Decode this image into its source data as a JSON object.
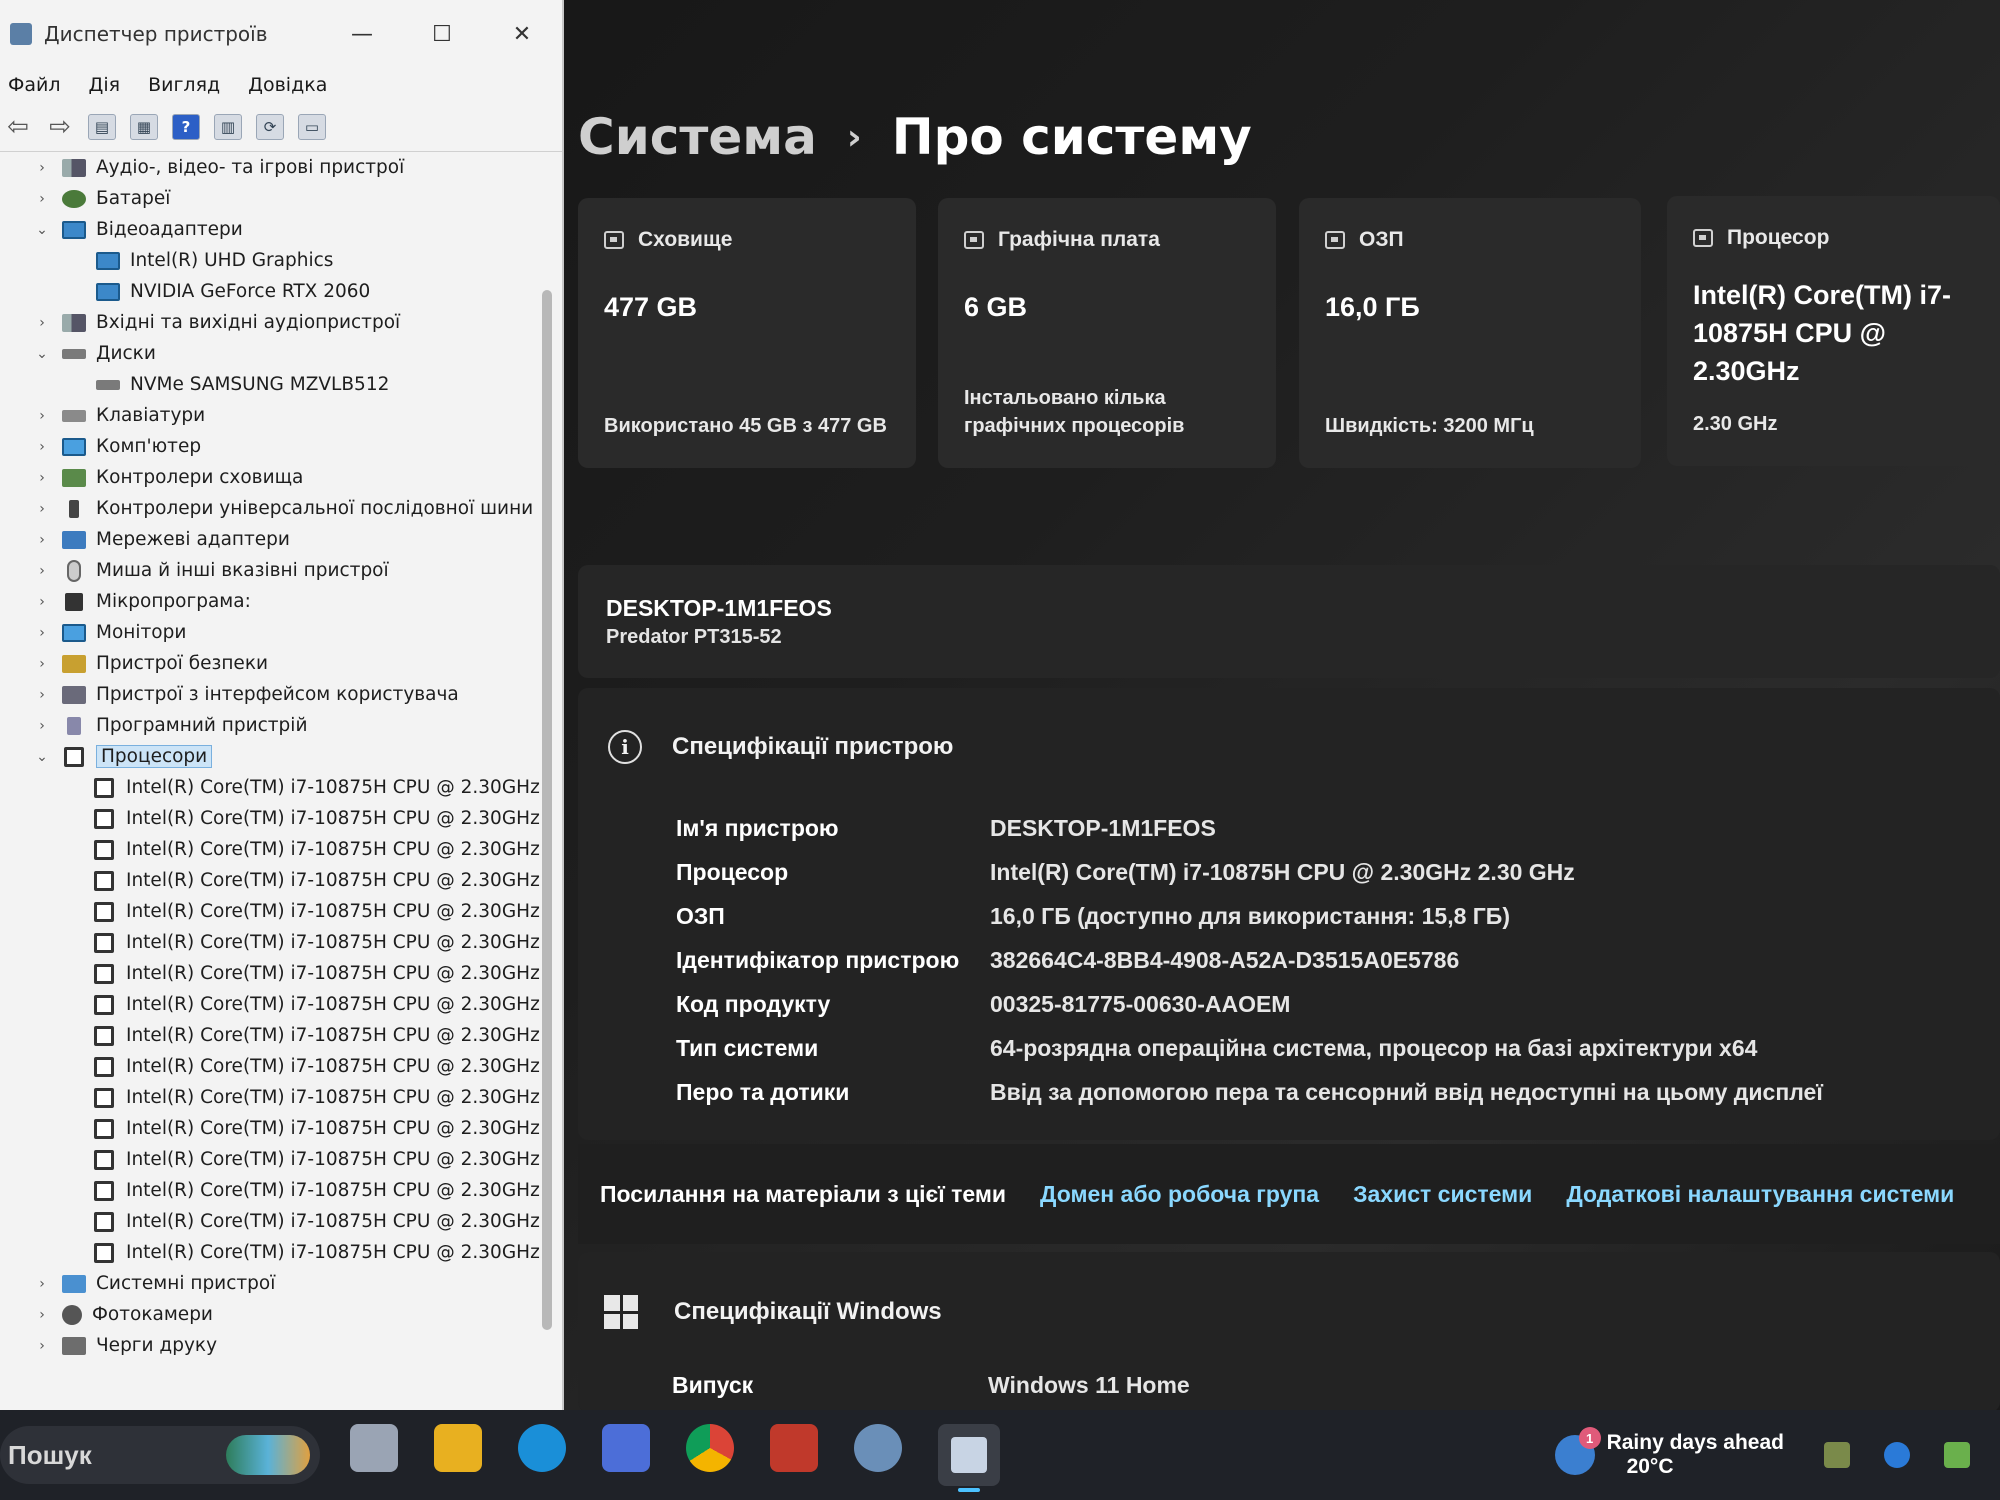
{
  "devmgr": {
    "title": "Диспетчер пристроїв",
    "window_buttons": [
      "—",
      "☐",
      "✕"
    ],
    "menu": [
      "Файл",
      "Дія",
      "Вигляд",
      "Довідка"
    ],
    "tree": [
      {
        "label": "Аудіо-, відео- та ігрові пристрої",
        "icon": "audio-icon",
        "expanded": false
      },
      {
        "label": "Батареї",
        "icon": "battery-icon",
        "expanded": false
      },
      {
        "label": "Відеоадаптери",
        "icon": "display-adapter-icon",
        "expanded": true
      },
      {
        "label": "Intel(R) UHD Graphics",
        "icon": "display-adapter-icon",
        "child": true
      },
      {
        "label": "NVIDIA GeForce RTX 2060",
        "icon": "display-adapter-icon",
        "child": true
      },
      {
        "label": "Вхідні та вихідні аудіопристрої",
        "icon": "audio-icon",
        "expanded": false
      },
      {
        "label": "Диски",
        "icon": "disk-icon",
        "expanded": true
      },
      {
        "label": "NVMe SAMSUNG MZVLB512",
        "icon": "disk-icon",
        "child": true
      },
      {
        "label": "Клавіатури",
        "icon": "keyboard-icon",
        "expanded": false
      },
      {
        "label": "Комп'ютер",
        "icon": "computer-icon",
        "expanded": false
      },
      {
        "label": "Контролери сховища",
        "icon": "storage-controller-icon",
        "expanded": false
      },
      {
        "label": "Контролери універсальної послідовної шини",
        "icon": "usb-icon",
        "expanded": false
      },
      {
        "label": "Мережеві адаптери",
        "icon": "network-adapter-icon",
        "expanded": false
      },
      {
        "label": "Миша й інші вказівні пристрої",
        "icon": "mouse-icon",
        "expanded": false
      },
      {
        "label": "Мікропрограма:",
        "icon": "firmware-icon",
        "expanded": false
      },
      {
        "label": "Монітори",
        "icon": "monitor-icon",
        "expanded": false
      },
      {
        "label": "Пристрої безпеки",
        "icon": "security-device-icon",
        "expanded": false
      },
      {
        "label": "Пристрої з інтерфейсом користувача",
        "icon": "hid-icon",
        "expanded": false
      },
      {
        "label": "Програмний пристрій",
        "icon": "software-device-icon",
        "expanded": false
      },
      {
        "label": "Процесори",
        "icon": "processor-icon",
        "expanded": true,
        "selected": true
      }
    ],
    "cpu_entry": "Intel(R) Core(TM) i7-10875H CPU @ 2.30GHz",
    "cpu_count": 16,
    "tree_tail": [
      {
        "label": "Системні пристрої",
        "icon": "system-device-icon"
      },
      {
        "label": "Фотокамери",
        "icon": "camera-icon"
      },
      {
        "label": "Черги друку",
        "icon": "print-queue-icon"
      }
    ]
  },
  "settings": {
    "breadcrumb_parent": "Система",
    "breadcrumb_sep": "›",
    "breadcrumb_current": "Про систему",
    "cards": [
      {
        "title": "Сховище",
        "value": "477 GB",
        "sub": "Використано 45 GB з 477 GB",
        "icon": "storage-icon"
      },
      {
        "title": "Графічна плата",
        "value": "6 GB",
        "sub": "Інстальовано кілька графічних процесорів",
        "icon": "graphics-card-icon"
      },
      {
        "title": "ОЗП",
        "value": "16,0 ГБ",
        "sub": "Швидкість: 3200 МГц",
        "icon": "ram-icon"
      },
      {
        "title": "Процесор",
        "value": "Intel(R) Core(TM) i7-10875H CPU @ 2.30GHz",
        "sub": "2.30 GHz",
        "icon": "processor-icon"
      }
    ],
    "device_name": "DESKTOP-1M1FEOS",
    "device_model": "Predator PT315-52",
    "spec_title": "Специфікації пристрою",
    "specs": [
      {
        "label": "Ім'я пристрою",
        "value": "DESKTOP-1M1FEOS"
      },
      {
        "label": "Процесор",
        "value": "Intel(R) Core(TM) i7-10875H CPU @ 2.30GHz   2.30 GHz"
      },
      {
        "label": "ОЗП",
        "value": "16,0 ГБ (доступно для використання: 15,8 ГБ)"
      },
      {
        "label": "Ідентифікатор пристрою",
        "value": "382664C4-8BB4-4908-A52A-D3515A0E5786"
      },
      {
        "label": "Код продукту",
        "value": "00325-81775-00630-AAOEM"
      },
      {
        "label": "Тип системи",
        "value": "64-розрядна операційна система, процесор на базі архітектури x64"
      },
      {
        "label": "Перо та дотики",
        "value": "Ввід за допомогою пера та сенсорний ввід недоступні на цьому дисплеї"
      }
    ],
    "links_label": "Посилання на матеріали з цієї теми",
    "links": [
      "Домен або робоча група",
      "Захист системи",
      "Додаткові налаштування системи"
    ],
    "windows_title": "Специфікації Windows",
    "windows_rows": [
      {
        "label": "Випуск",
        "value": "Windows 11 Home"
      }
    ]
  },
  "taskbar": {
    "search_label": "Пошук",
    "apps": [
      "task-view-icon",
      "file-explorer-icon",
      "edge-icon",
      "store-icon",
      "chrome-icon",
      "game-app-icon",
      "settings-icon",
      "device-manager-icon"
    ],
    "weather_text": "Rainy days ahead",
    "weather_temp": "20°C",
    "weather_badge": "1"
  },
  "colors": {
    "link": "#8ad8ff",
    "accent": "#4cc2ff"
  }
}
